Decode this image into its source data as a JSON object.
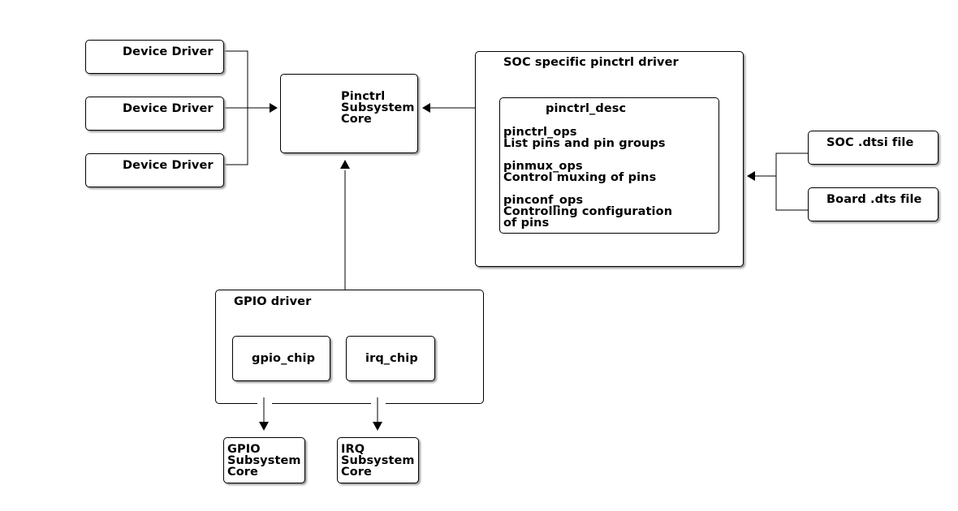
{
  "diagram": {
    "device_drivers": [
      "Device Driver",
      "Device Driver",
      "Device Driver"
    ],
    "pinctrl_core": {
      "lines": [
        "Pinctrl",
        "Subsystem",
        "Core"
      ]
    },
    "soc_driver": {
      "title": "SOC specific pinctrl driver",
      "desc": {
        "title": "pinctrl_desc",
        "ops": [
          {
            "name": "pinctrl_ops",
            "desc": "List pins and pin groups"
          },
          {
            "name": "pinmux_ops",
            "desc": "Control muxing of pins"
          },
          {
            "name": "pinconf_ops",
            "desc": "Controlling configuration",
            "desc2": "of pins"
          }
        ]
      }
    },
    "dt_files": [
      "SOC .dtsi file",
      "Board .dts file"
    ],
    "gpio_driver": {
      "title": "GPIO driver",
      "chips": [
        "gpio_chip",
        "irq_chip"
      ]
    },
    "gpio_core": {
      "lines": [
        "GPIO",
        "Subsystem",
        "Core"
      ]
    },
    "irq_core": {
      "lines": [
        "IRQ",
        "Subsystem",
        "Core"
      ]
    },
    "edges": [
      {
        "from": "Device Driver (x3)",
        "to": "Pinctrl Subsystem Core"
      },
      {
        "from": "SOC specific pinctrl driver",
        "to": "Pinctrl Subsystem Core"
      },
      {
        "from": "GPIO driver",
        "to": "Pinctrl Subsystem Core"
      },
      {
        "from": "SOC .dtsi file / Board .dts file",
        "to": "SOC specific pinctrl driver"
      },
      {
        "from": "gpio_chip",
        "to": "GPIO Subsystem Core"
      },
      {
        "from": "irq_chip",
        "to": "IRQ Subsystem Core"
      }
    ]
  }
}
